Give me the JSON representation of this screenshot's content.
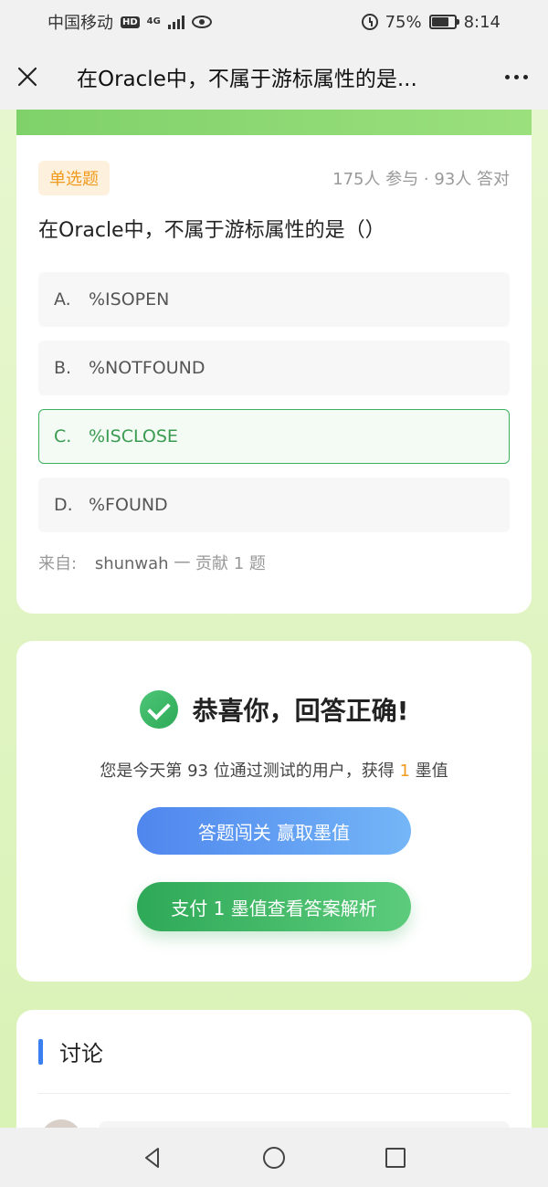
{
  "status_bar": {
    "carrier": "中国移动",
    "hd": "HD",
    "network": "4G",
    "battery": "75%",
    "time": "8:14"
  },
  "nav": {
    "title": "在Oracle中，不属于游标属性的是..."
  },
  "question": {
    "type": "单选题",
    "stats": "175人 参与 · 93人 答对",
    "text": "在Oracle中，不属于游标属性的是（）",
    "options": [
      {
        "letter": "A.",
        "text": "%ISOPEN"
      },
      {
        "letter": "B.",
        "text": "%NOTFOUND"
      },
      {
        "letter": "C.",
        "text": "%ISCLOSE"
      },
      {
        "letter": "D.",
        "text": "%FOUND"
      }
    ],
    "selected_option": "C",
    "from_label": "来自:",
    "author": "shunwah",
    "contrib": "一 贡献 1 题"
  },
  "result": {
    "title": "恭喜你，回答正确!",
    "sub_prefix": "您是今天第 93 位通过测试的用户，获得",
    "sub_value": "1",
    "sub_suffix": "墨值",
    "btn_challenge": "答题闯关 赢取墨值",
    "btn_pay": "支付 1 墨值查看答案解析"
  },
  "discussion": {
    "title": "讨论"
  },
  "colors": {
    "accent_green": "#3db060",
    "accent_orange": "#f09a1e",
    "accent_blue": "#3b7ff0"
  }
}
